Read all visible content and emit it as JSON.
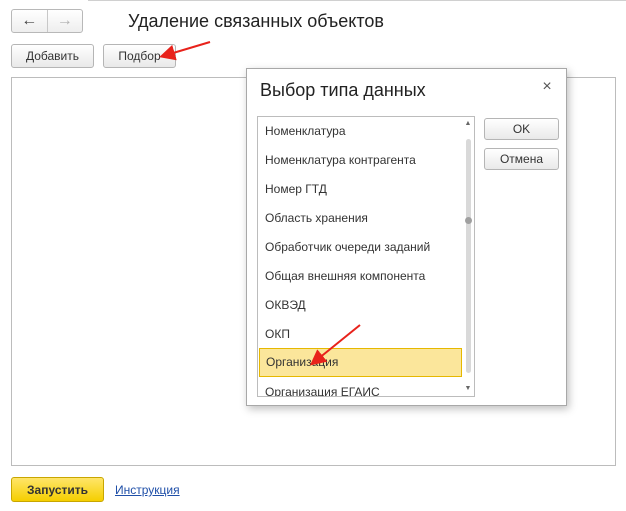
{
  "page": {
    "title": "Удаление связанных объектов"
  },
  "toolbar": {
    "back_icon": "←",
    "forward_icon": "→",
    "add_label": "Добавить",
    "pick_label": "Подбор"
  },
  "footer": {
    "run_label": "Запустить",
    "instruction_label": "Инструкция"
  },
  "dialog": {
    "title": "Выбор типа данных",
    "close_icon": "×",
    "ok_label": "OK",
    "cancel_label": "Отмена",
    "items": [
      "Номенклатура",
      "Номенклатура контрагента",
      "Номер ГТД",
      "Область хранения",
      "Обработчик очереди заданий",
      "Общая внешняя компонента",
      "ОКВЭД",
      "ОКП",
      "Организация",
      "Организация ЕГАИС"
    ],
    "selected_item": "Организация"
  },
  "colors": {
    "accent_yellow": "#f5cf00",
    "selection": "#fbe69b",
    "annotation_arrow": "#e8221b",
    "link": "#1f4fa8"
  },
  "icons": {
    "back": "arrow-left-icon",
    "forward": "arrow-right-icon",
    "close": "close-icon",
    "scroll_up": "chevron-up-icon",
    "scroll_down": "chevron-down-icon"
  }
}
